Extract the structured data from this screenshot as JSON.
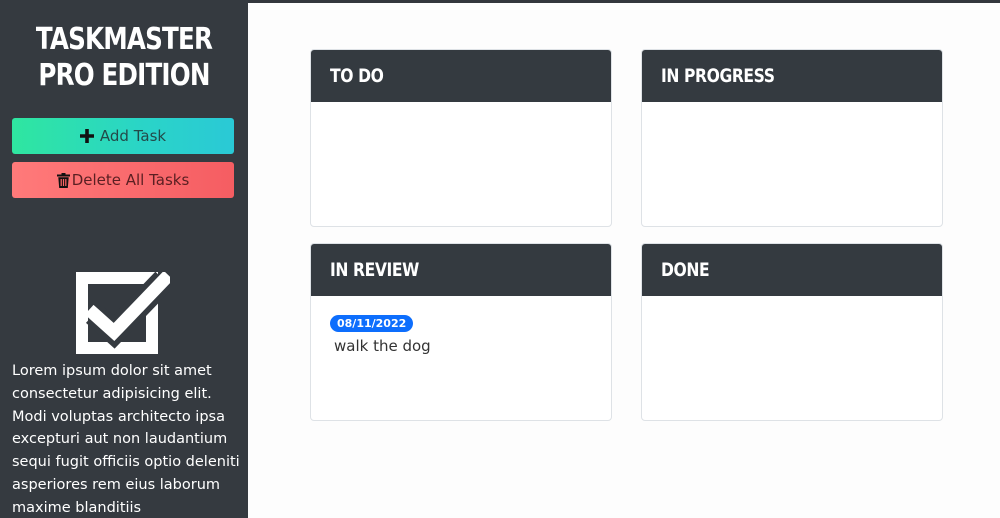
{
  "sidebar": {
    "title_line1": "TASKMASTER",
    "title_line2": "PRO EDITION",
    "add_button_label": "Add Task",
    "delete_button_label": "Delete All Tasks",
    "logo_icon": "checkbox-check-icon",
    "about_text": "Lorem ipsum dolor sit amet consectetur adipisicing elit. Modi voluptas architecto ipsa excepturi aut non laudantium sequi fugit officiis optio deleniti asperiores rem eius laborum maxime blanditiis"
  },
  "colors": {
    "sidebar_bg": "#353a40",
    "add_button": "#2ad4c8",
    "delete_button": "#f55d62",
    "column_header": "#343a40",
    "date_badge": "#0d6efd"
  },
  "columns": [
    {
      "title": "TO DO",
      "tasks": []
    },
    {
      "title": "IN PROGRESS",
      "tasks": []
    },
    {
      "title": "IN REVIEW",
      "tasks": [
        {
          "date": "08/11/2022",
          "text": "walk the dog"
        }
      ]
    },
    {
      "title": "DONE",
      "tasks": []
    }
  ]
}
